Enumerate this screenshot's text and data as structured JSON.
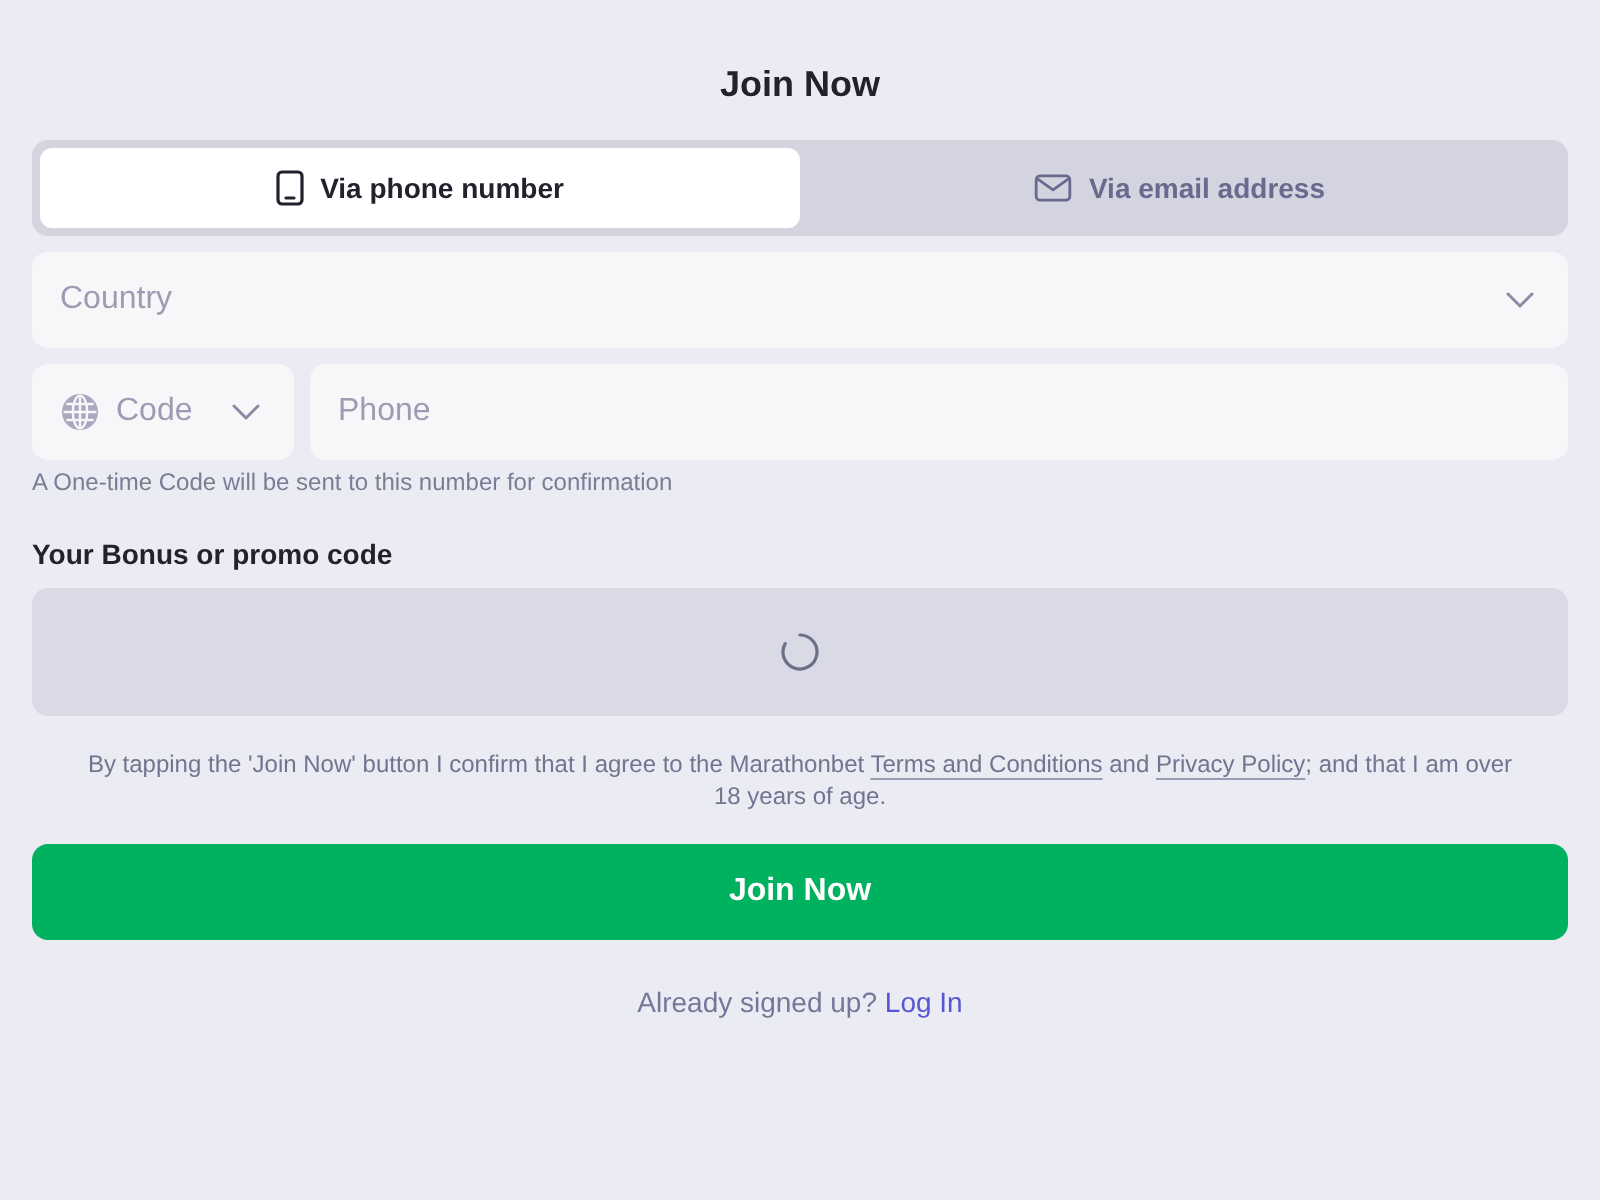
{
  "title": "Join Now",
  "tabs": [
    {
      "kind": "phone",
      "label": "Via phone number",
      "selected": true
    },
    {
      "kind": "email",
      "label": "Via email address",
      "selected": false
    }
  ],
  "country": {
    "placeholder": "Country"
  },
  "code": {
    "placeholder": "Code"
  },
  "phone": {
    "placeholder": "Phone"
  },
  "hint": "A One-time Code will be sent to this number for confirmation",
  "promo": {
    "label": "Your Bonus or promo code",
    "loading": true
  },
  "terms": [
    {
      "kind": "text",
      "text": "By tapping the 'Join Now' button I confirm that I agree to the Marathonbet "
    },
    {
      "kind": "link",
      "text": "Terms and Conditions"
    },
    {
      "kind": "text",
      "text": " and "
    },
    {
      "kind": "link",
      "text": "Privacy Policy"
    },
    {
      "kind": "text",
      "text": "; and that I am over 18 years of age."
    }
  ],
  "submit": {
    "label": "Join Now"
  },
  "login": {
    "text": "Already signed up?",
    "link": "Log In"
  }
}
